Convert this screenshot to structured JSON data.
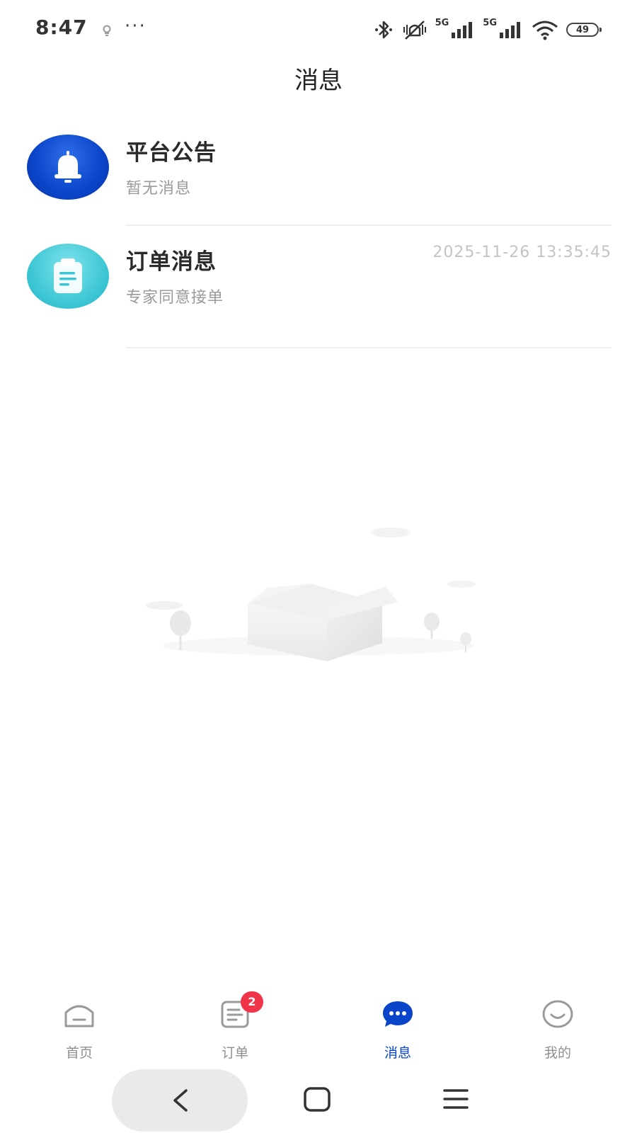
{
  "status_bar": {
    "time": "8:47",
    "more": "···",
    "network_1": "5G",
    "network_2": "5G",
    "battery": "49"
  },
  "header": {
    "title": "消息"
  },
  "messages": [
    {
      "title": "平台公告",
      "subtitle": "暂无消息",
      "time": "",
      "icon": "bell-icon",
      "icon_color": "#0a45c9"
    },
    {
      "title": "订单消息",
      "subtitle": "专家同意接单",
      "time": "2025-11-26 13:35:45",
      "icon": "clipboard-icon",
      "icon_color": "#3cc6d4"
    }
  ],
  "empty_state": {
    "illustration": "empty-box-illustration"
  },
  "tab_bar": {
    "tabs": [
      {
        "label": "首页",
        "icon": "home-icon",
        "active": false
      },
      {
        "label": "订单",
        "icon": "order-icon",
        "active": false,
        "badge": "2"
      },
      {
        "label": "消息",
        "icon": "message-icon",
        "active": true
      },
      {
        "label": "我的",
        "icon": "profile-icon",
        "active": false
      }
    ],
    "active_color": "#0a45c9",
    "badge_color": "#f0344a"
  },
  "system_nav": {
    "buttons": [
      "back-icon",
      "home-square-icon",
      "menu-icon"
    ]
  }
}
